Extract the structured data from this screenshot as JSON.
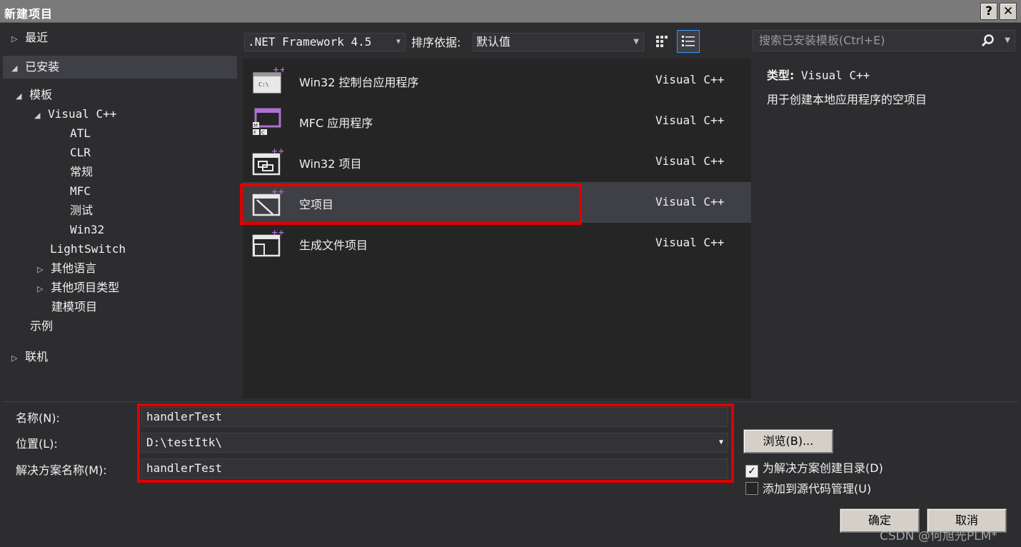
{
  "window": {
    "title": "新建项目",
    "help_label": "?",
    "close_label": "✕"
  },
  "tree": {
    "recent": "最近",
    "installed": "已安装",
    "templates": "模板",
    "visual_cpp": "Visual C++",
    "atl": "ATL",
    "clr": "CLR",
    "general": "常规",
    "mfc": "MFC",
    "test": "测试",
    "win32": "Win32",
    "lightswitch": "LightSwitch",
    "other_languages": "其他语言",
    "other_project_types": "其他项目类型",
    "modeling_projects": "建模项目",
    "samples": "示例",
    "online": "联机"
  },
  "toolbar": {
    "framework": ".NET Framework 4.5",
    "sort_label": "排序依据:",
    "sort_value": "默认值",
    "search_placeholder": "搜索已安装模板(Ctrl+E)"
  },
  "templates": [
    {
      "name": "Win32 控制台应用程序",
      "lang": "Visual C++",
      "icon": "console-app-icon"
    },
    {
      "name": "MFC 应用程序",
      "lang": "Visual C++",
      "icon": "mfc-app-icon"
    },
    {
      "name": "Win32 项目",
      "lang": "Visual C++",
      "icon": "win32-project-icon"
    },
    {
      "name": "空项目",
      "lang": "Visual C++",
      "icon": "empty-project-icon",
      "selected": true
    },
    {
      "name": "生成文件项目",
      "lang": "Visual C++",
      "icon": "makefile-project-icon"
    }
  ],
  "info": {
    "type_label": "类型:",
    "type_value": "Visual C++",
    "description": "用于创建本地应用程序的空项目"
  },
  "form": {
    "name_label": "名称(N):",
    "name_value": "handlerTest",
    "location_label": "位置(L):",
    "location_value": "D:\\testItk\\",
    "solution_label": "解决方案名称(M):",
    "solution_value": "handlerTest",
    "browse_label": "浏览(B)...",
    "create_dir_label": "为解决方案创建目录(D)",
    "create_dir_checked": true,
    "source_control_label": "添加到源代码管理(U)",
    "source_control_checked": false,
    "ok_label": "确定",
    "cancel_label": "取消"
  },
  "watermark": "CSDN @何旭光PLM*",
  "colors": {
    "highlight": "#e00000",
    "accent": "#3399ff",
    "background": "#2d2d30"
  }
}
